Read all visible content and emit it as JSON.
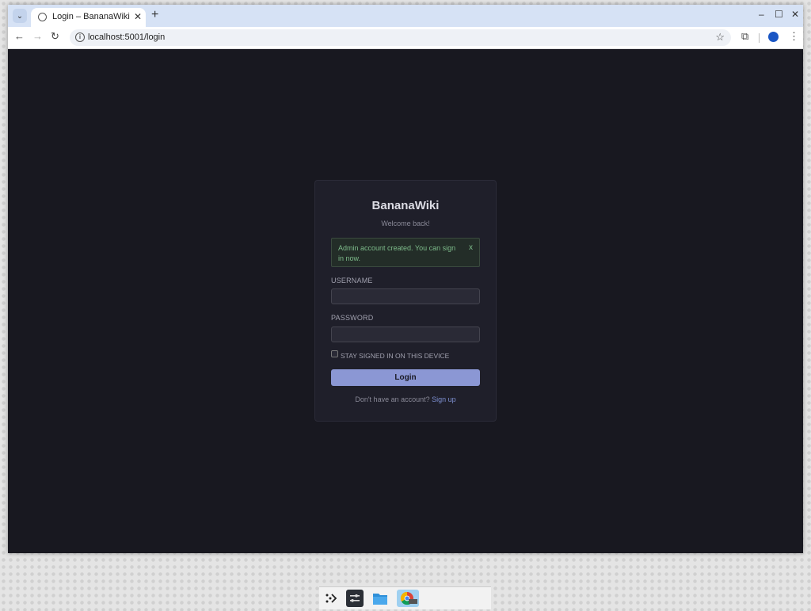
{
  "browser": {
    "tab_title": "Login – BananaWiki",
    "url": "localhost:5001/login",
    "icons": [
      "tab-list-icon",
      "globe-icon",
      "close-icon",
      "plus-icon",
      "back-icon",
      "forward-icon",
      "reload-icon",
      "info-icon",
      "star-icon",
      "extensions-icon",
      "profile-icon",
      "menu-icon",
      "minimize-icon",
      "maximize-icon",
      "close-window-icon"
    ]
  },
  "login": {
    "brand": "BananaWiki",
    "subtitle": "Welcome back!",
    "alert_message": "Admin account created. You can sign in now.",
    "alert_dismiss": "x",
    "username_label": "USERNAME",
    "username_value": "",
    "password_label": "PASSWORD",
    "password_value": "",
    "remember_label": "STAY SIGNED IN ON THIS DEVICE",
    "remember_checked": false,
    "submit_label": "Login",
    "footer_text": "Don't have an account?",
    "signup_link": "Sign up"
  },
  "taskbar": {
    "apps": [
      "launcher-icon",
      "settings-icon",
      "files-icon",
      "chrome-icon"
    ]
  },
  "colors": {
    "page_bg": "#181820",
    "card_bg": "#1f1f2a",
    "accent": "#8b97d4",
    "alert_text": "#7dbb8a"
  }
}
